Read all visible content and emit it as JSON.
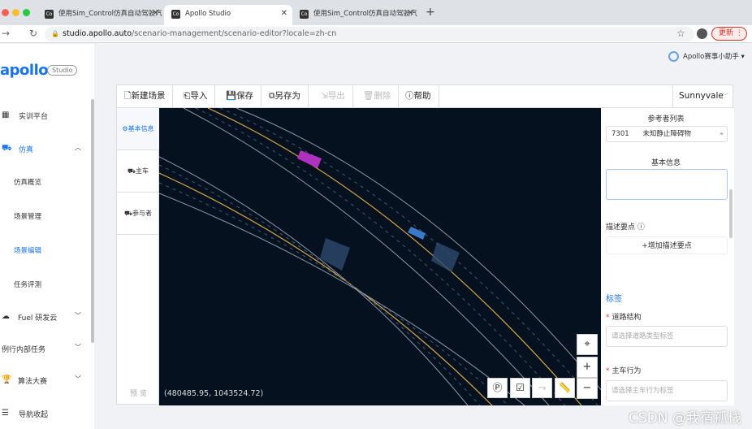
{
  "browser": {
    "tabs": [
      {
        "label": "使用Sim_Control仿真自动驾驶汽"
      },
      {
        "label": "Apollo Studio"
      },
      {
        "label": "使用Sim_Control仿真自动驾驶汽"
      }
    ],
    "url_host": "studio.apollo.auto",
    "url_path": "/scenario-management/scenario-editor?locale=zh-cn",
    "update_label": "更新"
  },
  "sidebar": {
    "logo": "apollo",
    "logo_badge": "Studio",
    "items": [
      {
        "label": "实训平台"
      },
      {
        "label": "仿真"
      },
      {
        "label": "仿真概览"
      },
      {
        "label": "场景管理"
      },
      {
        "label": "场景编辑"
      },
      {
        "label": "任务评测"
      },
      {
        "label": "Fuel 研发云"
      },
      {
        "label": "例行内部任务"
      },
      {
        "label": "算法大赛"
      },
      {
        "label": "导航收起"
      }
    ]
  },
  "user": {
    "name": "Apollo赛事小助手"
  },
  "toolbar": {
    "new": "新建场景",
    "import": "导入",
    "save": "保存",
    "save_as": "另存为",
    "export": "导出",
    "delete": "删除",
    "help": "帮助",
    "map_select": "Sunnyvale"
  },
  "left_tabs": {
    "basic": "基本信息",
    "main_car": "主车",
    "participants": "参与者",
    "preview": "预 览"
  },
  "map": {
    "coordinates": "(480485.95, 1043524.72)"
  },
  "right_panel": {
    "participants_title": "参考者列表",
    "participant_id": "7301",
    "participant_type": "未知静止障碍物",
    "basic_info_title": "基本信息",
    "describe_points_label": "描述要点",
    "add_describe_point": "+增加描述要点",
    "tags_title": "标签",
    "road_structure_label": "道路结构",
    "road_structure_placeholder": "请选择道路类型标签",
    "main_car_behavior_label": "主车行为",
    "main_car_behavior_placeholder": "请选择主车行为标签"
  },
  "watermark": "CSDN @我宿孤栈"
}
